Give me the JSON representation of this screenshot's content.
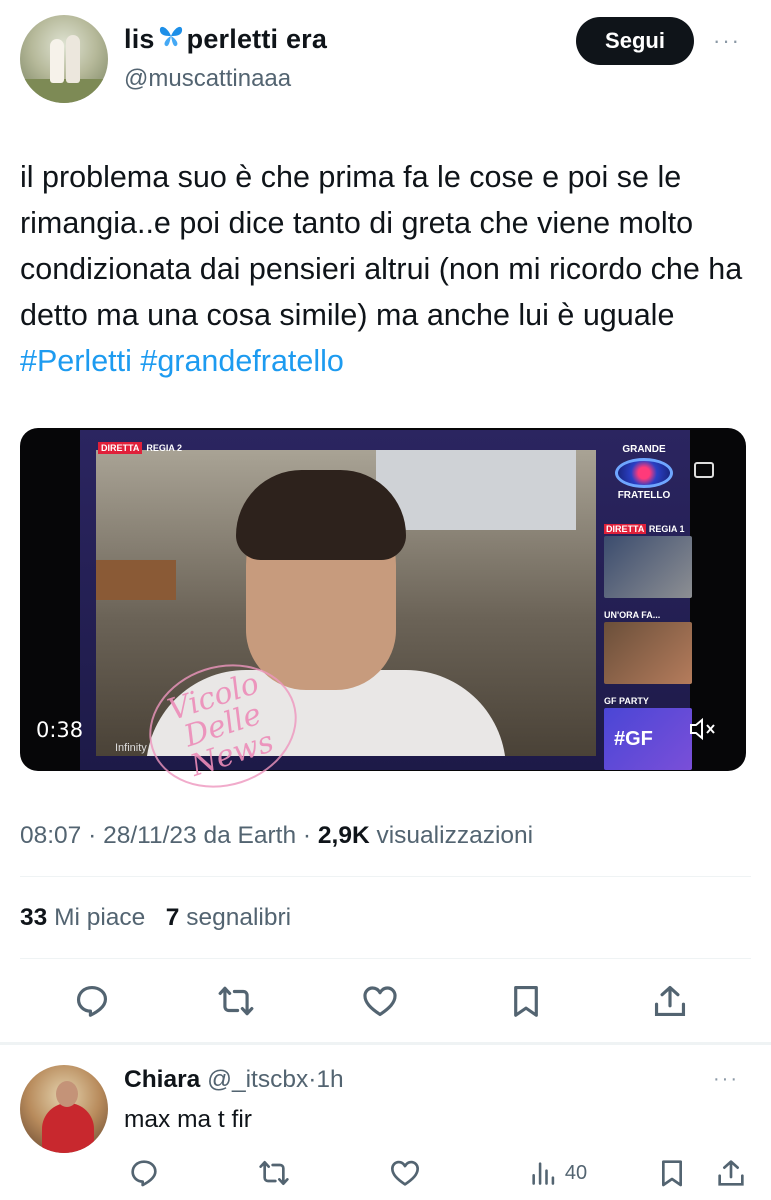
{
  "tweet": {
    "author": {
      "name_left": "lis",
      "name_emoji": "🦋",
      "name_right": "perletti era",
      "handle": "@muscattinaaa"
    },
    "follow_label": "Segui",
    "more": "···",
    "text_plain": "il problema suo è che prima fa le cose e poi se le rimangia..e poi dice tanto di greta che viene molto condizionata dai pensieri altrui (non mi ricordo che ha detto ma una cosa simile) ma anche lui è uguale ",
    "hashtags": [
      "#Perletti",
      "#grandefratello"
    ],
    "media": {
      "duration": "0:38",
      "live_badge": "DIRETTA",
      "live_channel": "REGIA 2",
      "logo_top": "GRANDE",
      "logo_bottom": "FRATELLO",
      "thumb1_badge": "DIRETTA",
      "thumb1_label": "REGIA 1",
      "thumb2_label": "UN'ORA FA...",
      "thumb3_label": "GF PARTY",
      "thumb3_tag": "#GF",
      "broadcaster": "Infinity",
      "watermark": "Vicolo Delle News"
    },
    "meta": {
      "time": "08:07",
      "date": "28/11/23",
      "source": "da Earth",
      "views_value": "2,9K",
      "views_label": "visualizzazioni"
    },
    "stats": {
      "likes_value": "33",
      "likes_label": "Mi piace",
      "bookmarks_value": "7",
      "bookmarks_label": "segnalibri"
    }
  },
  "reply": {
    "name": "Chiara",
    "handle": "@_itscbx",
    "time": "1h",
    "text": "max ma t fir",
    "views": "40",
    "more": "···"
  },
  "icons": {
    "reply": "reply-icon",
    "retweet": "retweet-icon",
    "like": "heart-icon",
    "bookmark": "bookmark-icon",
    "share": "share-icon",
    "views": "views-icon",
    "color_icon": "#536471",
    "color_link": "#1d9bf0"
  }
}
